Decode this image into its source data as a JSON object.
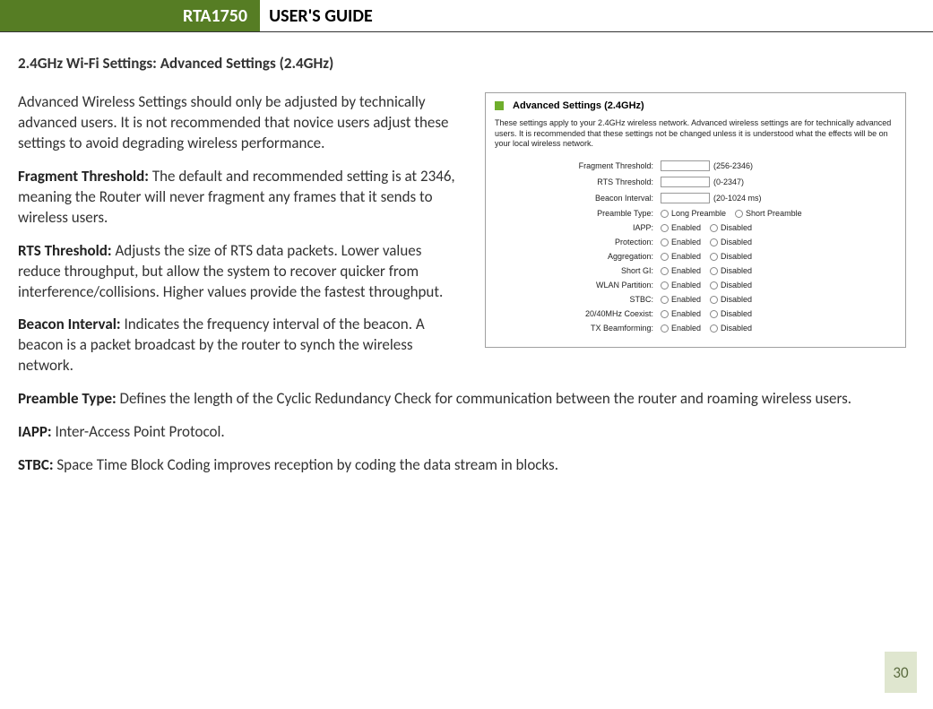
{
  "header": {
    "model": "RTA1750",
    "title": "USER'S GUIDE"
  },
  "section_title": "2.4GHz Wi-Fi Settings: Advanced Settings (2.4GHz)",
  "intro": "Advanced Wireless Settings should only be adjusted by technically advanced users. It is not recommended that novice users adjust these settings to avoid degrading wireless performance.",
  "defs": {
    "frag": {
      "term": "Fragment Threshold:",
      "text": " The default and recommended setting is at 2346, meaning the Router will never fragment any frames that it sends to wireless users."
    },
    "rts": {
      "term": "RTS Threshold:",
      "text": " Adjusts the size of RTS data packets. Lower values reduce throughput, but allow the system to recover quicker from interference/collisions. Higher values provide the fastest throughput."
    },
    "beacon": {
      "term": "Beacon Interval:",
      "text": " Indicates the frequency interval of the beacon. A beacon is a packet broadcast by the router to synch the wireless network."
    },
    "preamble": {
      "term": "Preamble Type:",
      "text": " Defines the length of the Cyclic Redundancy Check for communication between the router and roaming wireless users."
    },
    "iapp": {
      "term": "IAPP:",
      "text": " Inter-Access Point Protocol."
    },
    "stbc": {
      "term": "STBC:",
      "text": " Space Time Block Coding improves reception by coding the data stream in blocks."
    }
  },
  "panel": {
    "title": "Advanced Settings (2.4GHz)",
    "desc": "These settings apply to your 2.4GHz wireless network. Advanced wireless settings are for technically advanced users. It is recommended that these settings not be changed unless it is understood what the effects will be on your local wireless network.",
    "rows": {
      "frag": {
        "label": "Fragment Threshold:",
        "hint": "(256-2346)"
      },
      "rts": {
        "label": "RTS Threshold:",
        "hint": "(0-2347)"
      },
      "beacon": {
        "label": "Beacon Interval:",
        "hint": "(20-1024 ms)"
      },
      "preamble": {
        "label": "Preamble Type:",
        "opt1": "Long Preamble",
        "opt2": "Short Preamble"
      },
      "iapp": {
        "label": "IAPP:"
      },
      "protection": {
        "label": "Protection:"
      },
      "aggregation": {
        "label": "Aggregation:"
      },
      "shortgi": {
        "label": "Short GI:"
      },
      "wlan": {
        "label": "WLAN Partition:"
      },
      "stbc": {
        "label": "STBC:"
      },
      "coexist": {
        "label": "20/40MHz Coexist:"
      },
      "txbf": {
        "label": "TX Beamforming:"
      }
    },
    "enabled": "Enabled",
    "disabled": "Disabled"
  },
  "page_number": "30"
}
